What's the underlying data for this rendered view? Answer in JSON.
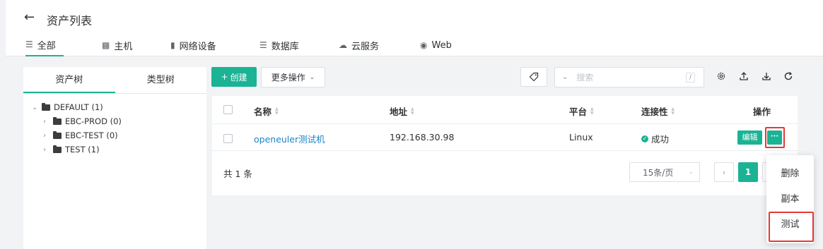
{
  "header": {
    "title": "资产列表",
    "tabs": [
      {
        "label": "全部",
        "icon": "list-icon"
      },
      {
        "label": "主机",
        "icon": "host-icon"
      },
      {
        "label": "网络设备",
        "icon": "network-device-icon"
      },
      {
        "label": "数据库",
        "icon": "database-icon"
      },
      {
        "label": "云服务",
        "icon": "cloud-icon"
      },
      {
        "label": "Web",
        "icon": "globe-icon"
      }
    ],
    "active_tab": "全部"
  },
  "left_panel": {
    "tabs": [
      "资产树",
      "类型树"
    ],
    "active_tab": "资产树",
    "tree": {
      "root": "DEFAULT (1)",
      "children": [
        "EBC-PROD (0)",
        "EBC-TEST (0)",
        "TEST (1)"
      ]
    }
  },
  "toolbar": {
    "create_label": "创建",
    "more_label": "更多操作",
    "search_placeholder": "搜索",
    "search_shortcut": "/"
  },
  "table": {
    "columns": [
      "名称",
      "地址",
      "平台",
      "连接性",
      "操作"
    ],
    "rows": [
      {
        "name": "openeuler测试机",
        "address": "192.168.30.98",
        "platform": "Linux",
        "connectivity": "成功",
        "edit_label": "编辑",
        "more_label": "···"
      }
    ]
  },
  "pagination": {
    "total": "共 1 条",
    "page_size": "15条/页",
    "current_page": "1"
  },
  "dropdown_menu": {
    "items": [
      "删除",
      "副本",
      "测试"
    ]
  },
  "colors": {
    "accent": "#1ab394",
    "link": "#1c84c6",
    "highlight": "#e53935"
  }
}
